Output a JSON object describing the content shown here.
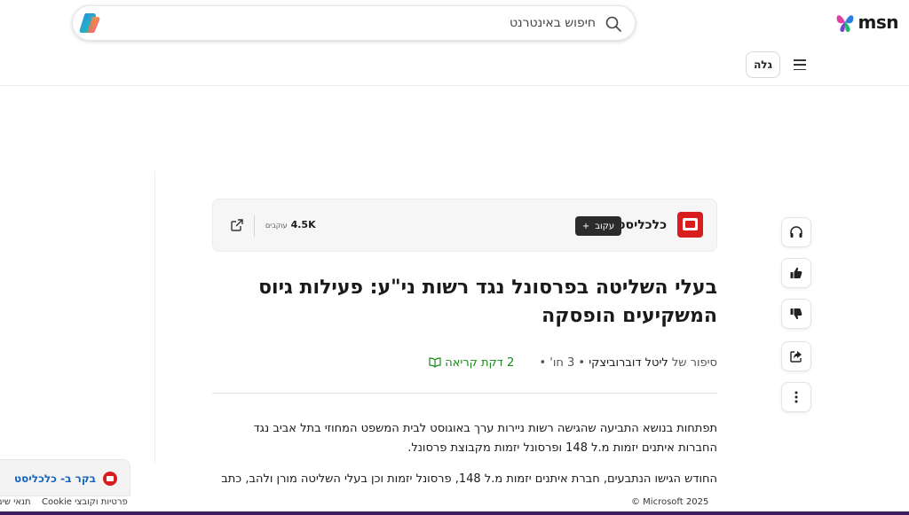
{
  "header": {
    "brand": "msn",
    "search_placeholder": "חיפוש באינטרנט",
    "discover_label": "גלה"
  },
  "publisher": {
    "name": "כלכליסט",
    "follow_label": "עקוב",
    "follow_plus": "+",
    "followers_count": "4.5K",
    "followers_label": "עוקבים",
    "brand_color": "#d71d1d"
  },
  "article": {
    "headline": "בעלי השליטה בפרסונל נגד רשות ני\"ע: פעילות גיוס המשקיעים הופסקה",
    "byline_prefix": "סיפור של",
    "author": "ליטל דוברוביצקי",
    "date": "3 חו'",
    "read_time": "2 דקת קריאה",
    "paragraphs": [
      "תפתחות בנושא התביעה שהגישה רשות ניירות ערך באוגוסט לבית המשפט המחוזי בתל אביב נגד החברות איתנים יזמות מ.ל 148 ופרסונל יזמות מקבוצת פרסונל.",
      "החודש הגישו הנתבעים, חברת איתנים יזמות מ.ל 148, פרסונל יזמות וכן בעלי השליטה מורן ולהב, כתב"
    ]
  },
  "actions": {
    "icons": [
      "headphones-icon",
      "thumbs-up-icon",
      "thumbs-down-icon",
      "share-icon",
      "more-icon"
    ]
  },
  "visit": {
    "label": "בקר ב- כלכליסט"
  },
  "footer": {
    "copyright": "© Microsoft 2025",
    "privacy": "פרטיות וקובצי Cookie",
    "terms": "תנאי שימוש"
  }
}
